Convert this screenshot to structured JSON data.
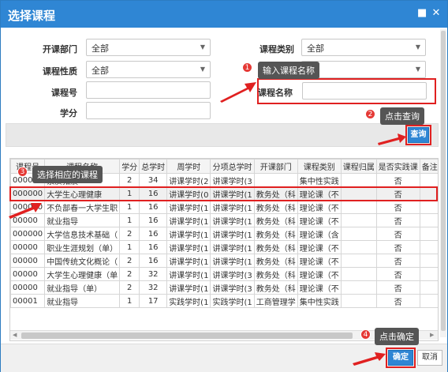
{
  "dialog": {
    "title": "选择课程",
    "minimize_icon": "square-icon",
    "close_icon": "close-icon"
  },
  "form": {
    "dept_label": "开课部门",
    "dept_value": "全部",
    "category_label": "课程类别",
    "category_value": "全部",
    "nature_label": "课程性质",
    "nature_value": "全部",
    "code_label": "课程号",
    "code_value": "",
    "name_label": "课程名称",
    "name_value": "",
    "credit_label": "学分",
    "credit_value": ""
  },
  "callouts": {
    "c1_num": "1",
    "c1_text": "输入课程名称",
    "c2_num": "2",
    "c2_text": "点击查询",
    "c3_num": "3",
    "c3_text": "选择相应的课程",
    "c4_num": "4",
    "c4_text": "点击确定"
  },
  "toolbar": {
    "query_label": "查询"
  },
  "table": {
    "headers": [
      "课程号",
      "课程名称",
      "学分",
      "总学时",
      "周学时",
      "分项总学时",
      "开课部门",
      "课程类别",
      "课程归属",
      "是否实践课",
      "备注"
    ],
    "rows": [
      [
        "00000",
        "素质拓展",
        "2",
        "34",
        "讲课学时(2",
        "讲课学时(3",
        "",
        "集中性实践",
        "",
        "否",
        ""
      ],
      [
        "000000",
        "大学生心理健康",
        "1",
        "16",
        "讲课学时(0",
        "讲课学时(1",
        "教务处（科",
        "理论课（不",
        "",
        "否",
        ""
      ],
      [
        "000000",
        "不负部春一大学生职",
        "1",
        "16",
        "讲课学时(1",
        "讲课学时(1",
        "教务处（科",
        "理论课（不",
        "",
        "否",
        ""
      ],
      [
        "00000",
        "就业指导",
        "1",
        "16",
        "讲课学时(1",
        "讲课学时(1",
        "教务处（科",
        "理论课（不",
        "",
        "否",
        ""
      ],
      [
        "000000",
        "大学信息技术基础（",
        "2",
        "16",
        "讲课学时(1",
        "讲课学时(1",
        "教务处（科",
        "理论课（含",
        "",
        "否",
        ""
      ],
      [
        "00000",
        "职业生涯规划（单）",
        "1",
        "16",
        "讲课学时(1",
        "讲课学时(1",
        "教务处（科",
        "理论课（不",
        "",
        "否",
        ""
      ],
      [
        "00000",
        "中国传统文化概论（",
        "2",
        "16",
        "讲课学时(1",
        "讲课学时(1",
        "教务处（科",
        "理论课（不",
        "",
        "否",
        ""
      ],
      [
        "00000",
        "大学生心理健康（单",
        "2",
        "32",
        "讲课学时(1",
        "讲课学时(3",
        "教务处（科",
        "理论课（不",
        "",
        "否",
        ""
      ],
      [
        "00000",
        "就业指导（单）",
        "2",
        "32",
        "讲课学时(1",
        "讲课学时(3",
        "教务处（科",
        "理论课（不",
        "",
        "否",
        ""
      ],
      [
        "00001",
        "就业指导",
        "1",
        "17",
        "实践学时(1",
        "实践学时(1",
        "工商管理学",
        "集中性实践",
        "",
        "否",
        ""
      ]
    ]
  },
  "footer": {
    "ok_label": "确定",
    "cancel_label": "取消"
  },
  "colors": {
    "title_bar": "#2f86d4",
    "highlight": "#e02020",
    "callout_bg": "#555555",
    "badge": "#e53935"
  }
}
